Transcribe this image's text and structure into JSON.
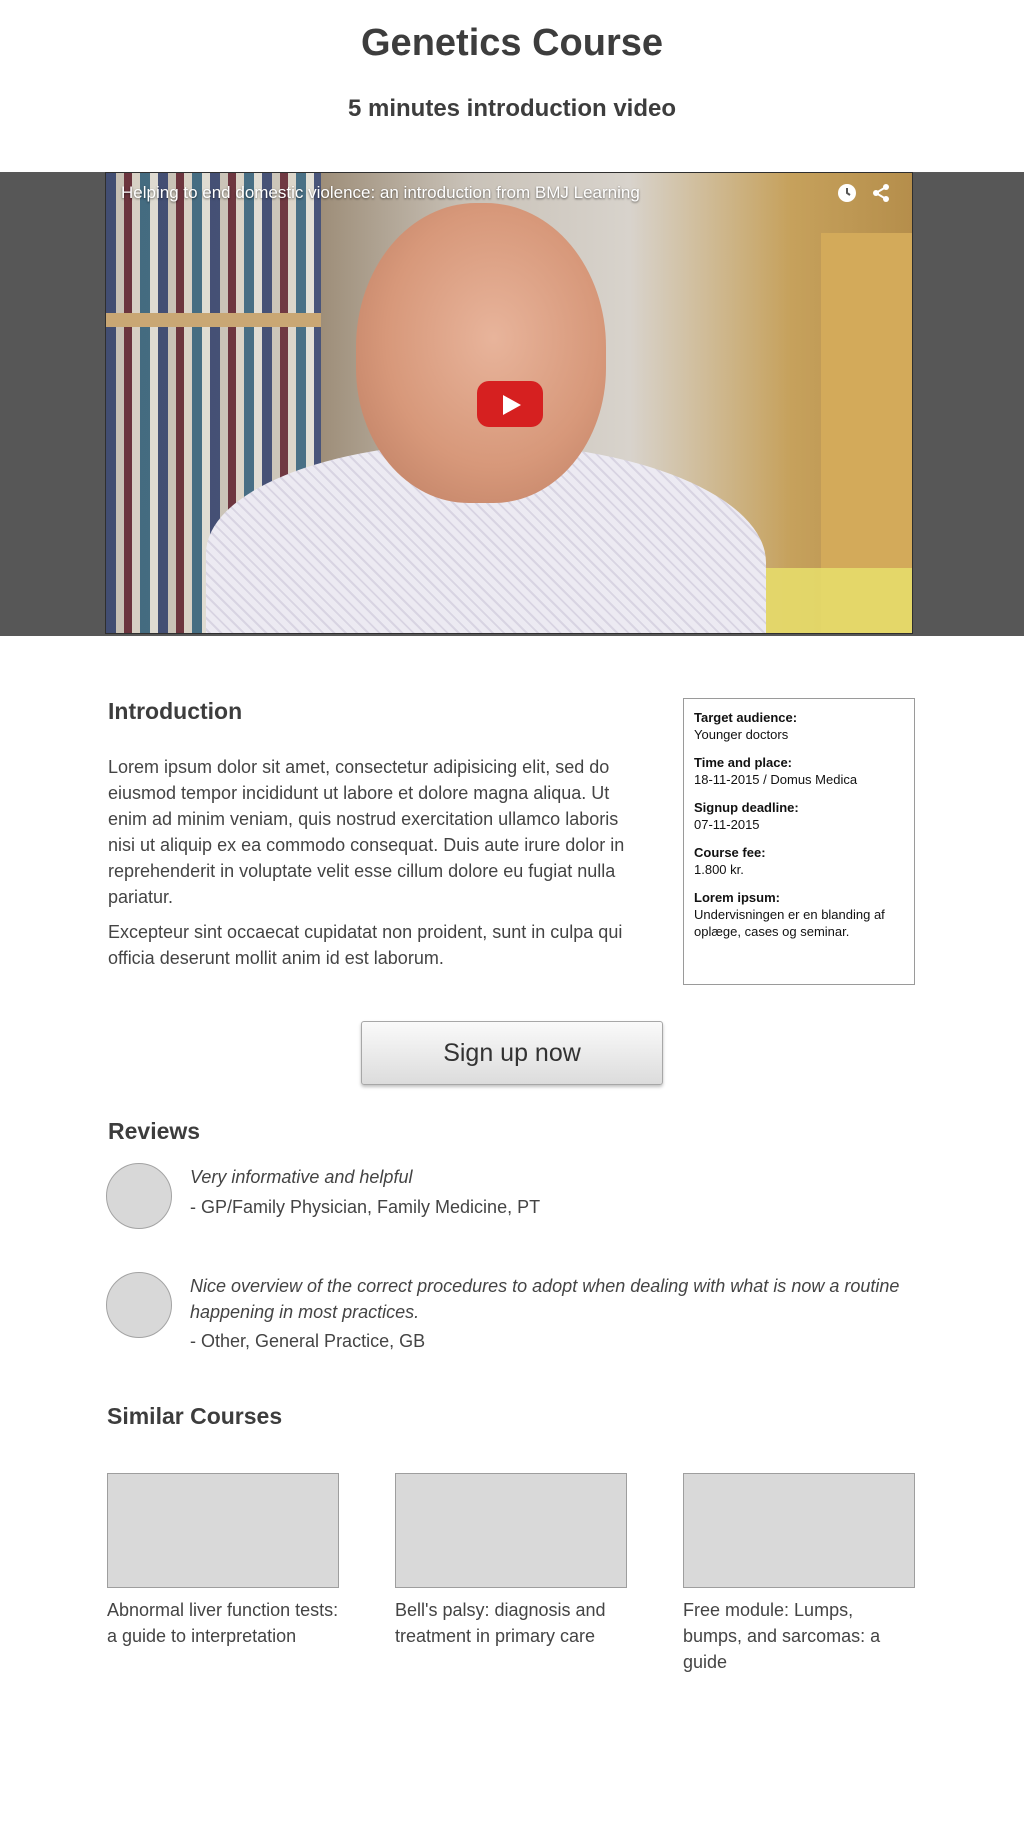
{
  "header": {
    "title": "Genetics Course",
    "subtitle": "5 minutes introduction video"
  },
  "video": {
    "title": "Helping to end domestic violence: an introduction from BMJ Learning",
    "icons": [
      "clock-icon",
      "share-icon",
      "play-icon"
    ]
  },
  "introduction": {
    "heading": "Introduction",
    "paragraph1": "Lorem ipsum dolor sit amet, consectetur adipisicing elit, sed do eiusmod tempor incididunt ut labore et dolore magna aliqua. Ut enim ad minim veniam, quis nostrud exercitation ullamco laboris nisi ut aliquip ex ea commodo consequat. Duis aute irure dolor in reprehenderit in voluptate velit esse cillum dolore eu fugiat nulla pariatur.",
    "paragraph2": "Excepteur sint occaecat cupidatat non proident, sunt in culpa qui officia deserunt mollit anim id est laborum."
  },
  "info": [
    {
      "label": "Target audience:",
      "value": "Younger doctors"
    },
    {
      "label": "Time and place:",
      "value": "18-11-2015 / Domus Medica"
    },
    {
      "label": "Signup deadline:",
      "value": "07-11-2015"
    },
    {
      "label": "Course fee:",
      "value": "1.800 kr."
    },
    {
      "label": "Lorem ipsum:",
      "value": "Undervisningen er en blanding af oplæge, cases og seminar."
    }
  ],
  "signup_label": "Sign up now",
  "reviews": {
    "heading": "Reviews",
    "items": [
      {
        "quote": "Very informative and helpful",
        "author": "- GP/Family Physician, Family Medicine, PT"
      },
      {
        "quote": "Nice overview of the correct procedures to adopt when dealing with what is now a routine happening in most practices.",
        "author": "- Other, General Practice, GB"
      }
    ]
  },
  "similar": {
    "heading": "Similar Courses",
    "courses": [
      {
        "title": "Abnormal liver function tests: a guide to interpretation"
      },
      {
        "title": "Bell's palsy: diagnosis and treatment in primary care"
      },
      {
        "title": "Free module: Lumps, bumps, and sarcomas: a guide"
      }
    ]
  }
}
